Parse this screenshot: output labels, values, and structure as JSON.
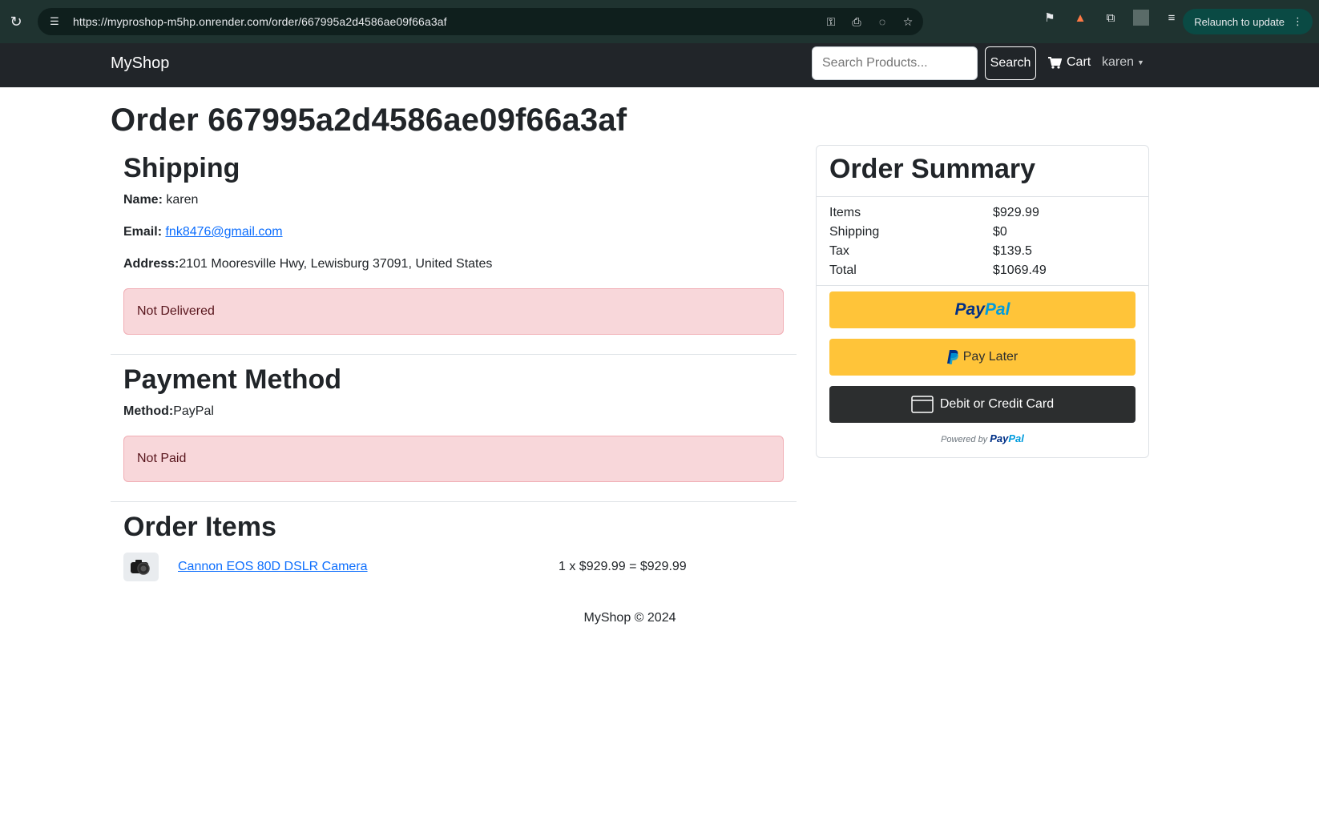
{
  "browser": {
    "url": "https://myproshop-m5hp.onrender.com/order/667995a2d4586ae09f66a3af",
    "relaunch_label": "Relaunch to update"
  },
  "navbar": {
    "brand": "MyShop",
    "search_placeholder": "Search Products...",
    "search_button": "Search",
    "cart_label": "Cart",
    "user_label": "karen"
  },
  "page": {
    "title": "Order 667995a2d4586ae09f66a3af"
  },
  "shipping": {
    "heading": "Shipping",
    "name_label": "Name:",
    "name_value": "karen",
    "email_label": "Email:",
    "email_value": "fnk8476@gmail.com",
    "address_label": "Address:",
    "address_value": "2101 Mooresville Hwy, Lewisburg 37091, United States",
    "status": "Not Delivered"
  },
  "payment": {
    "heading": "Payment Method",
    "method_label": "Method:",
    "method_value": "PayPal",
    "status": "Not Paid"
  },
  "order_items": {
    "heading": "Order Items",
    "items": [
      {
        "name": "Cannon EOS 80D DSLR Camera",
        "calc": "1 x $929.99 = $929.99"
      }
    ]
  },
  "summary": {
    "heading": "Order Summary",
    "rows": [
      {
        "label": "Items",
        "value": "$929.99"
      },
      {
        "label": "Shipping",
        "value": "$0"
      },
      {
        "label": "Tax",
        "value": "$139.5"
      },
      {
        "label": "Total",
        "value": "$1069.49"
      }
    ],
    "paypal_logo_a": "Pay",
    "paypal_logo_b": "Pal",
    "pay_later_label": "Pay Later",
    "card_label": "Debit or Credit Card",
    "powered_by": "Powered by"
  },
  "footer": {
    "text": "MyShop © 2024"
  },
  "colors": {
    "navbar": "#212529",
    "alert_bg": "#f8d7da",
    "paypal_yellow": "#ffc439",
    "link": "#0d6efd"
  }
}
